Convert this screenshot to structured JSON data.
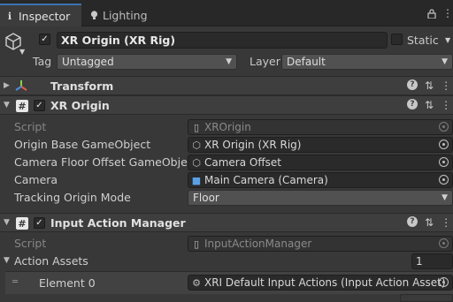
{
  "tabs": [
    {
      "label": "Inspector",
      "icon": "info-icon"
    },
    {
      "label": "Lighting",
      "icon": "lightbulb-icon"
    }
  ],
  "window_controls": {
    "lock": "🔒",
    "menu": "⋮"
  },
  "gameobject": {
    "active": true,
    "name": "XR Origin (XR Rig)",
    "static_label": "Static",
    "tag_label": "Tag",
    "tag_value": "Untagged",
    "layer_label": "Layer",
    "layer_value": "Default"
  },
  "components": {
    "transform": {
      "title": "Transform"
    },
    "xr_origin": {
      "title": "XR Origin",
      "enabled": true,
      "props": {
        "script_label": "Script",
        "script_value": "XROrigin",
        "base_label": "Origin Base GameObject",
        "base_value": "XR Origin (XR Rig)",
        "floor_label": "Camera Floor Offset GameObject",
        "floor_value": "Camera Offset",
        "camera_label": "Camera",
        "camera_value": "Main Camera (Camera)",
        "tracking_label": "Tracking Origin Mode",
        "tracking_value": "Floor"
      }
    },
    "input_action_manager": {
      "title": "Input Action Manager",
      "enabled": true,
      "props": {
        "script_label": "Script",
        "script_value": "InputActionManager",
        "assets_label": "Action Assets",
        "assets_count": "1",
        "element_label": "Element 0",
        "element_value": "XRI Default Input Actions (Input Action Asset)"
      }
    }
  },
  "colors": {
    "accent": "#3a72b0",
    "panel": "#383838",
    "field": "#2a2a2a"
  }
}
